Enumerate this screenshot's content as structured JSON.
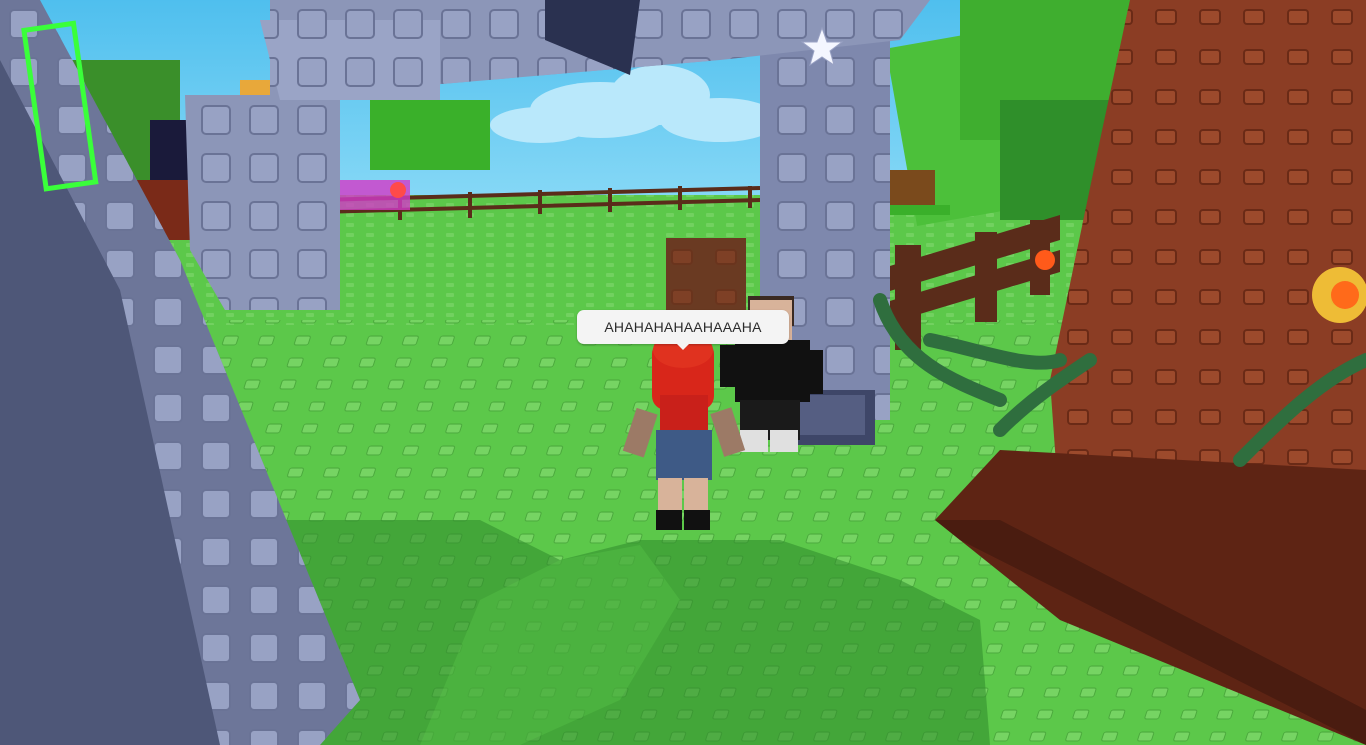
{
  "scene": {
    "sky_color": "#5fc8ee",
    "grass_color": "#5cc84a",
    "grass_stud_color": "#7ad866",
    "shadow_color": "#2f8a2c",
    "stone_color": "#8c96b8",
    "stone_dark_color": "#5d6688",
    "tree_trunk_color": "#8b3d24",
    "tree_trunk_dark_color": "#5e2414",
    "fence_color": "#5a2c1a",
    "leaf_color": "#4cc03a",
    "leaf_dark_color": "#2f8f2a"
  },
  "players": {
    "red_hair_avatar": {
      "icon": "avatar-red-hair",
      "hair_color": "#d8261a",
      "shirt_color": "#3e5a86"
    },
    "dark_avatar": {
      "icon": "avatar-black-outfit",
      "hair_color": "#3a2a22",
      "shirt_color": "#111111"
    }
  },
  "chat": {
    "bubble_text": "AHAHAHAHAAHAAAHA"
  },
  "icons": {
    "star": "star-icon",
    "moon": "moon-icon"
  }
}
